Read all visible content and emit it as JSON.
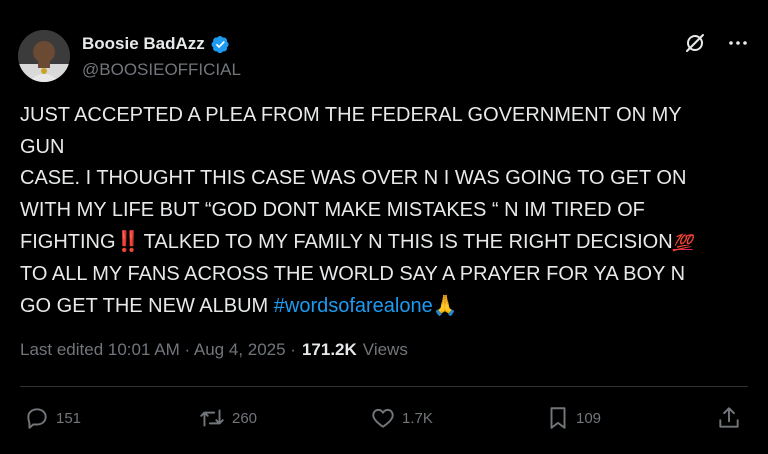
{
  "author": {
    "display_name": "Boosie BadAzz",
    "handle": "@BOOSIEOFFICIAL"
  },
  "tweet": {
    "lines": [
      "JUST ACCEPTED A PLEA FROM THE FEDERAL GOVERNMENT ON MY",
      "GUN",
      "CASE. I THOUGHT THIS CASE WAS OVER N I WAS GOING TO GET ON",
      "WITH MY LIFE BUT “GOD DONT MAKE MISTAKES “ N IM TIRED OF",
      "FIGHTING",
      "‼️",
      " TALKED TO MY FAMILY N THIS IS THE RIGHT DECISION",
      "💯",
      "TO ALL MY FANS ACROSS THE WORLD SAY A PRAYER FOR YA BOY N",
      "GO GET THE NEW ALBUM ",
      "#wordsofarealone",
      "🙏"
    ]
  },
  "meta": {
    "edited": "Last edited 10:01 AM · Aug 4, 2025 ·",
    "views_count": "171.2K",
    "views_label": "Views"
  },
  "actions": {
    "replies": "151",
    "reposts": "260",
    "likes": "1.7K",
    "bookmarks": "109"
  },
  "colors": {
    "background": "#000000",
    "text": "#e7e9ea",
    "secondary": "#71767b",
    "accent": "#1d9bf0",
    "divider": "#2f3336"
  }
}
